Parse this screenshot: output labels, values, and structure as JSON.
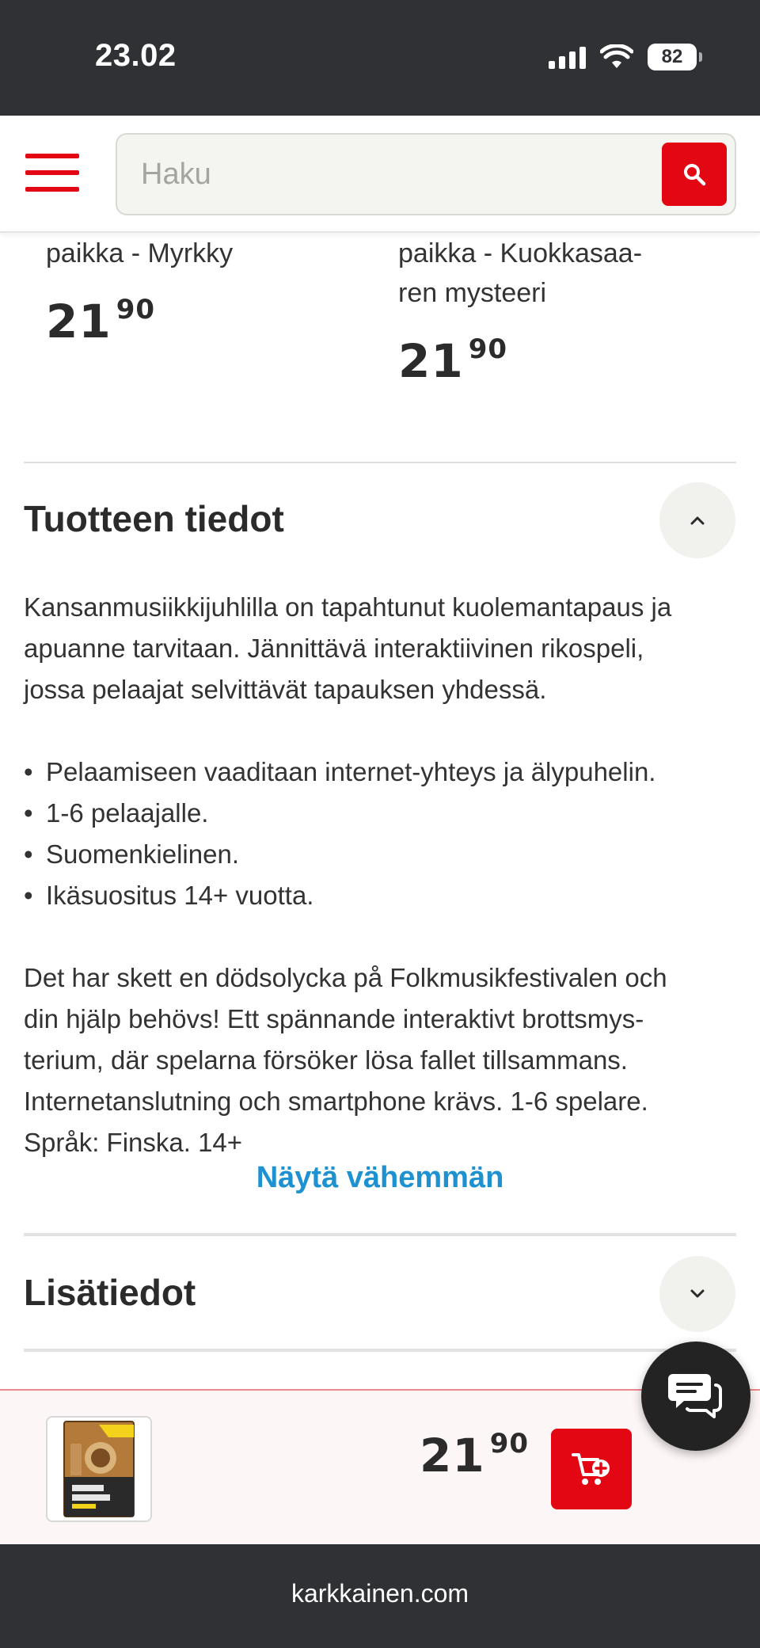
{
  "status_bar": {
    "time": "23.02",
    "battery": "82",
    "icons": [
      "cellular-signal-icon",
      "wifi-icon",
      "battery-icon"
    ]
  },
  "header": {
    "menu_icon": "hamburger-menu-icon",
    "search": {
      "placeholder": "Haku",
      "value": ""
    },
    "search_icon": "search-icon"
  },
  "related_products": [
    {
      "title_fragment": "paikka - Myrkky",
      "price_int": "21",
      "price_dec": "90"
    },
    {
      "title_fragment_line1": "paikka - Kuokkasaa-",
      "title_fragment_line2": "ren mysteeri",
      "price_int": "21",
      "price_dec": "90"
    }
  ],
  "product_info": {
    "heading": "Tuotteen tiedot",
    "toggle_icon": "chevron-up-icon",
    "intro_lines": [
      "Kansanmusiikkijuhlilla on tapahtunut kuolemantapaus ja",
      "apuanne tarvitaan. Jännittävä interaktiivinen rikospeli,",
      "jossa pelaajat selvittävät tapauksen yhdessä."
    ],
    "bullets": [
      "Pelaamiseen vaaditaan internet-yhteys ja älypuhelin.",
      "1-6 pelaajalle.",
      "Suomenkielinen.",
      "Ikäsuositus 14+ vuotta."
    ],
    "swedish_lines": [
      "Det har skett en dödsolycka på Folkmusikfestivalen och",
      "din hjälp behövs! Ett spännande interaktivt brottsmys-",
      "terium, där spelarna försöker lösa fallet tillsammans.",
      "Internetanslutning och smartphone krävs. 1-6 spelare.",
      "Språk: Finska. 14+"
    ],
    "show_less": "Näytä vähemmän"
  },
  "additional_info": {
    "heading": "Lisätiedot",
    "toggle_icon": "chevron-down-icon"
  },
  "sticky_bar": {
    "product_image": "product-box-thumbnail",
    "price_int": "21",
    "price_dec": "90",
    "cart_icon": "add-to-cart-icon"
  },
  "chat": {
    "icon": "chat-bubbles-icon"
  },
  "browser": {
    "url": "karkkainen.com"
  },
  "colors": {
    "brand_red": "#e30613",
    "link_blue": "#1e92d0",
    "dark_bar": "#2f3134"
  }
}
